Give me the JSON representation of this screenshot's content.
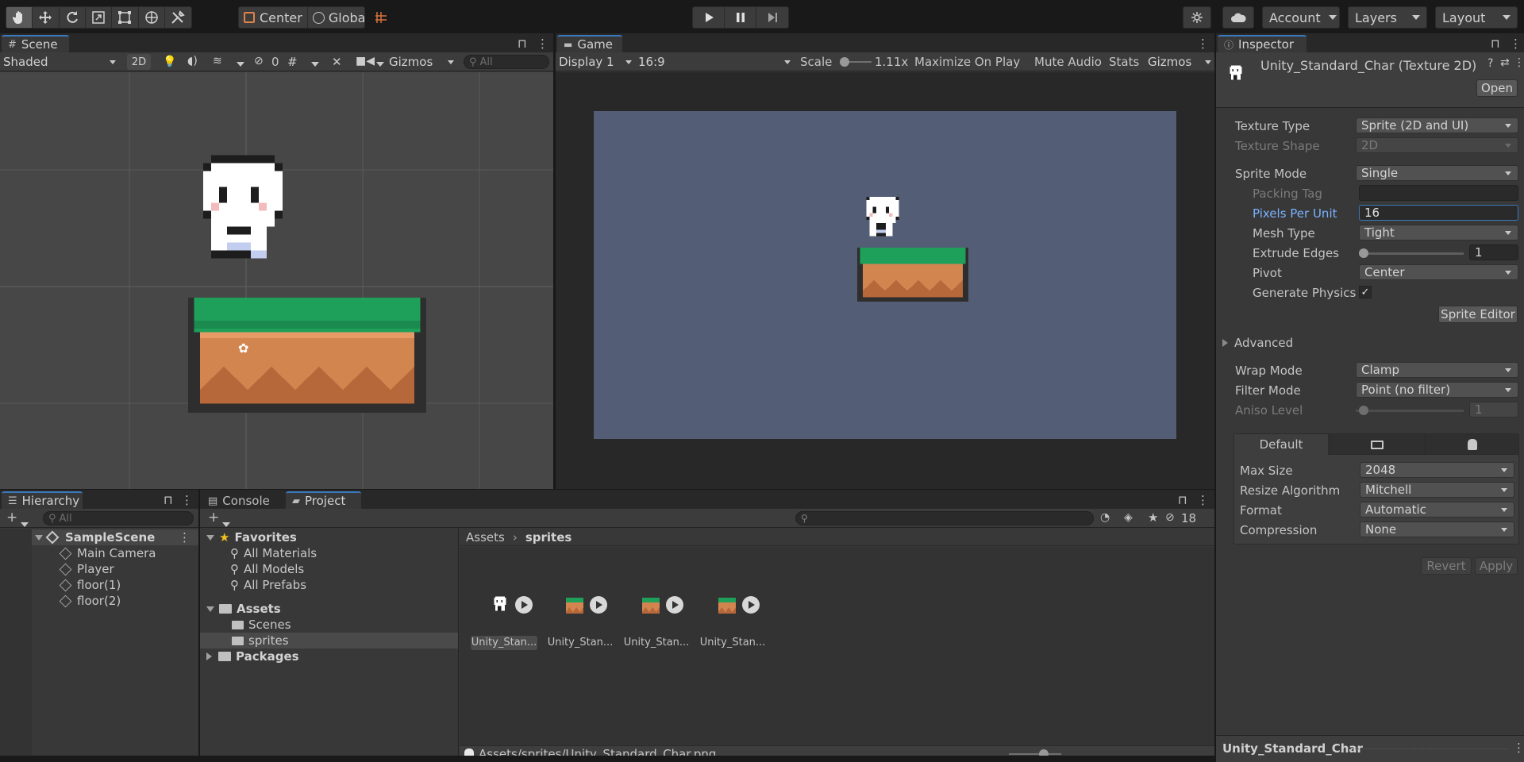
{
  "toolbar": {
    "pivot_mode": "Center",
    "pivot_rotation": "Global",
    "account_label": "Account",
    "layers_label": "Layers",
    "layout_label": "Layout"
  },
  "scene": {
    "tab_label": "Scene",
    "shading_mode": "Shaded",
    "mode_2d": "2D",
    "hidden_count": "0",
    "gizmos_label": "Gizmos",
    "search_placeholder": "All"
  },
  "game": {
    "tab_label": "Game",
    "display": "Display 1",
    "aspect": "16:9",
    "scale_label": "Scale",
    "scale_value": "1.11x",
    "maximize_label": "Maximize On Play",
    "mute_label": "Mute Audio",
    "stats_label": "Stats",
    "gizmos_label": "Gizmos",
    "background_color": "#535d75"
  },
  "inspector": {
    "tab_label": "Inspector",
    "asset_title": "Unity_Standard_Char (Texture 2D)",
    "open_label": "Open",
    "fields": {
      "texture_type": {
        "label": "Texture Type",
        "value": "Sprite (2D and UI)"
      },
      "texture_shape": {
        "label": "Texture Shape",
        "value": "2D"
      },
      "sprite_mode": {
        "label": "Sprite Mode",
        "value": "Single"
      },
      "packing_tag": {
        "label": "Packing Tag",
        "value": ""
      },
      "pixels_per_unit": {
        "label": "Pixels Per Unit",
        "value": "16"
      },
      "mesh_type": {
        "label": "Mesh Type",
        "value": "Tight"
      },
      "extrude_edges": {
        "label": "Extrude Edges",
        "value": "1"
      },
      "pivot": {
        "label": "Pivot",
        "value": "Center"
      },
      "generate_physics": {
        "label": "Generate Physics",
        "checked": true
      },
      "wrap_mode": {
        "label": "Wrap Mode",
        "value": "Clamp"
      },
      "filter_mode": {
        "label": "Filter Mode",
        "value": "Point (no filter)"
      },
      "aniso_level": {
        "label": "Aniso Level",
        "value": "1"
      }
    },
    "sprite_editor_label": "Sprite Editor",
    "advanced_label": "Advanced",
    "platform_default_label": "Default",
    "platform": {
      "max_size": {
        "label": "Max Size",
        "value": "2048"
      },
      "resize_algorithm": {
        "label": "Resize Algorithm",
        "value": "Mitchell"
      },
      "format": {
        "label": "Format",
        "value": "Automatic"
      },
      "compression": {
        "label": "Compression",
        "value": "None"
      }
    },
    "revert_label": "Revert",
    "apply_label": "Apply",
    "footer_title": "Unity_Standard_Char"
  },
  "hierarchy": {
    "tab_label": "Hierarchy",
    "search_placeholder": "All",
    "scene_name": "SampleScene",
    "items": [
      "Main Camera",
      "Player",
      "floor(1)",
      "floor(2)"
    ]
  },
  "project": {
    "console_tab": "Console",
    "project_tab": "Project",
    "hidden_count": "18",
    "favorites_label": "Favorites",
    "favorites": [
      "All Materials",
      "All Models",
      "All Prefabs"
    ],
    "assets_label": "Assets",
    "asset_folders": [
      "Scenes",
      "sprites"
    ],
    "packages_label": "Packages",
    "breadcrumb_root": "Assets",
    "breadcrumb_current": "sprites",
    "files": [
      "Unity_Stan...",
      "Unity_Stan...",
      "Unity_Stan...",
      "Unity_Stan..."
    ],
    "status_path": "Assets/sprites/Unity_Standard_Char.png"
  }
}
